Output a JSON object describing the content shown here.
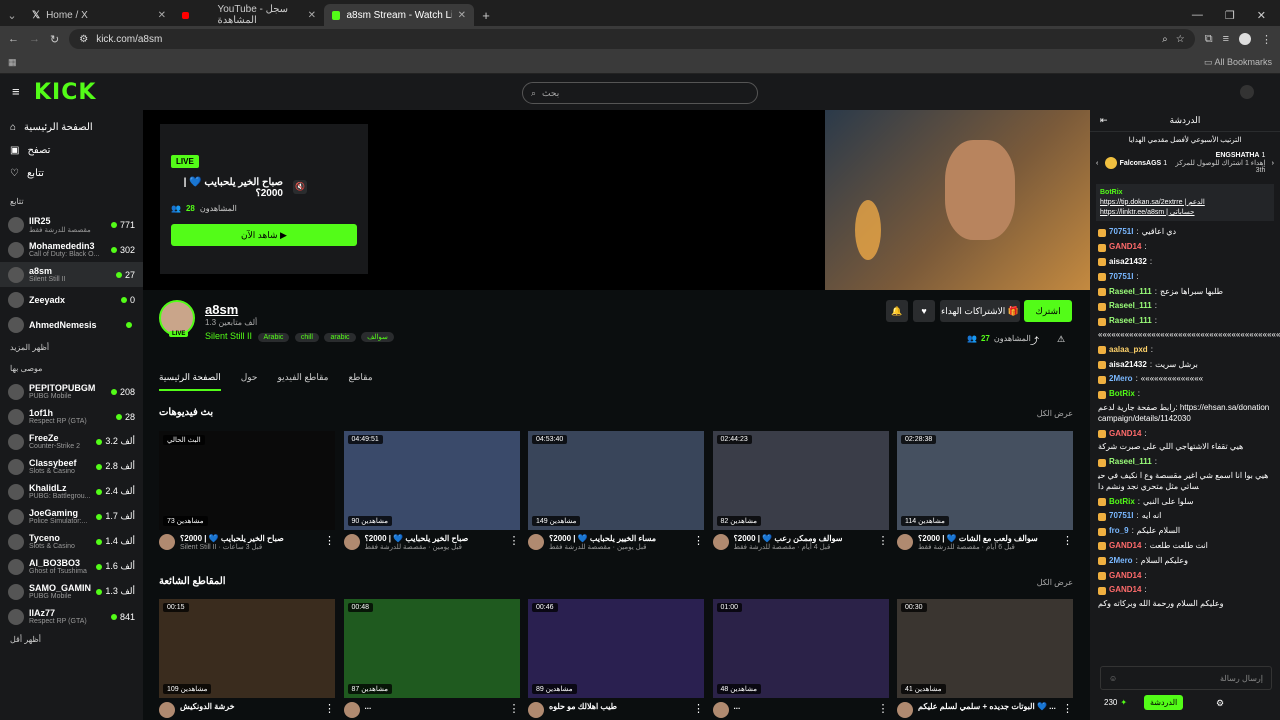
{
  "browser": {
    "tabs": [
      {
        "title": "Home / X"
      },
      {
        "title": "YouTube - سجل المشاهدة"
      },
      {
        "title": "a8sm Stream - Watch Live on Ki"
      }
    ],
    "url": "kick.com/a8sm",
    "bookmarks_label": "All Bookmarks"
  },
  "header": {
    "logo": "KICK",
    "search_placeholder": "بحث"
  },
  "sidebar": {
    "nav": [
      {
        "label": "الصفحة الرئيسية"
      },
      {
        "label": "تصفح"
      },
      {
        "label": "تتابع"
      }
    ],
    "following_title": "تتابع",
    "following": [
      {
        "name": "IIR25",
        "sub": "مقصصة للدرشة فقط",
        "viewers": "771"
      },
      {
        "name": "Mohamededin3",
        "sub": "Call of Duty: Black O...",
        "viewers": "302"
      },
      {
        "name": "a8sm",
        "sub": "Silent Still II",
        "viewers": "27"
      },
      {
        "name": "Zeeyadx",
        "sub": "",
        "viewers": "0"
      },
      {
        "name": "AhmedNemesis",
        "sub": "",
        "viewers": ""
      }
    ],
    "show_more": "أظهر المزيد",
    "recommended_title": "موصى بها",
    "recommended": [
      {
        "name": "PEPITOPUBGM",
        "sub": "PUBG Mobile",
        "viewers": "208"
      },
      {
        "name": "1of1h",
        "sub": "Respect RP (GTA)",
        "viewers": "28"
      },
      {
        "name": "FreeZe",
        "sub": "Counter-Strike 2",
        "viewers": "3.2 ألف"
      },
      {
        "name": "Classybeef",
        "sub": "Slots & Casino",
        "viewers": "2.8 ألف"
      },
      {
        "name": "KhalidLz",
        "sub": "PUBG: Battlegrou...",
        "viewers": "2.4 ألف"
      },
      {
        "name": "JoeGaming",
        "sub": "Police Simulator:...",
        "viewers": "1.7 ألف"
      },
      {
        "name": "Tyceno",
        "sub": "Slots & Casino",
        "viewers": "1.4 ألف"
      },
      {
        "name": "Al_BO3BO3",
        "sub": "Ghost of Tsushima",
        "viewers": "1.6 ألف"
      },
      {
        "name": "SAMO_GAMING",
        "sub": "PUBG Mobile",
        "viewers": "1.3 ألف"
      },
      {
        "name": "IIAz77",
        "sub": "Respect RP (GTA)",
        "viewers": "841"
      }
    ],
    "show_less": "أظهر أقل"
  },
  "stream": {
    "live_badge": "LIVE",
    "title": "صباح الخير يلحبايب 💙 | 2000؟",
    "viewers_label": "المشاهدون",
    "viewers": "28",
    "watch_now": "شاهد الآن ▶"
  },
  "channel": {
    "name": "a8sm",
    "followers": "1.3 ألف متابعين",
    "category": "Silent Still II",
    "tags": [
      "Arabic",
      "chill",
      "arabic",
      "سوالف"
    ],
    "subscribe": "اشترك",
    "gift_subs": "الاشتراكات الهداء",
    "viewers_label": "المشاهدون",
    "viewers": "27"
  },
  "channel_tabs": [
    {
      "label": "الصفحة الرئيسية"
    },
    {
      "label": "حول"
    },
    {
      "label": "مقاطع الفيديو"
    },
    {
      "label": "مقاطع"
    }
  ],
  "streams_section": {
    "title": "بث فيديوهات",
    "show_all": "عرض الكل",
    "items": [
      {
        "duration": "البث الحالي",
        "views": "73 مشاهدين",
        "title": "صباح الخير يلحبايب 💙 | 2000؟",
        "sub": "Silent Still II · قبل 3 ساعات"
      },
      {
        "duration": "04:49:51",
        "views": "90 مشاهدين",
        "title": "صباح الخير يلحبايب 💙 | 2000؟",
        "sub": "قبل يومين · مقصصة للدرشة فقط"
      },
      {
        "duration": "04:53:40",
        "views": "149 مشاهدين",
        "title": "مساء الخيير يلحبايب 💙 | 2000؟",
        "sub": "قبل يومين · مقصصة للدرشة فقط"
      },
      {
        "duration": "02:44:23",
        "views": "82 مشاهدين",
        "title": "سوالف وممكن رعب 💙 | 2000؟",
        "sub": "قبل 4 أيام · مقصصة للدرشة فقط"
      },
      {
        "duration": "02:28:38",
        "views": "114 مشاهدين",
        "title": "سوالف ولعب مع الشات 💙 | 2000؟",
        "sub": "قبل 6 أيام · مقصصة للدرشة فقط"
      }
    ]
  },
  "clips_section": {
    "title": "المقاطع الشائعة",
    "show_all": "عرض الكل",
    "items": [
      {
        "duration": "00:15",
        "views": "109 مشاهدين",
        "title": "خرشة الدونكيش"
      },
      {
        "duration": "00:48",
        "views": "87 مشاهدين",
        "title": "..."
      },
      {
        "duration": "00:46",
        "views": "89 مشاهدين",
        "title": "طيب اهلالك مو حلوه"
      },
      {
        "duration": "01:00",
        "views": "48 مشاهدين",
        "title": "..."
      },
      {
        "duration": "00:30",
        "views": "41 مشاهدين",
        "title": "البوتات جديده + سلمي لسلم عليكم 💙 ..."
      }
    ]
  },
  "chat": {
    "title": "الدردشة",
    "leaderboard_title": "الترتيب الأسبوعي لأفضل مقدمي الهدايا",
    "leader1": "FalconsAGS",
    "leader1_count": "1",
    "leader2": "ENGSHATHA",
    "leader2_count": "1",
    "leader2_sub": "إهداء 1 اشتراك للوصول للمركز 3th",
    "pinned_user": "BotRix",
    "pinned_text": "https://tip.dokan.sa/2extrre | الدعم",
    "pinned_text2": "https://linktr.ee/a8sm | حساباتي",
    "messages": [
      {
        "user": "70751I",
        "text": "دي اعاقيي",
        "color": "#7ab8ff"
      },
      {
        "user": "GAND14",
        "text": "",
        "color": "#ff6b6b"
      },
      {
        "user": "aisa21432",
        "text": "",
        "color": "#ffffff"
      },
      {
        "user": "70751I",
        "text": "",
        "color": "#7ab8ff"
      },
      {
        "user": "Raseel_111",
        "text": "طلبها سبراها مزعج",
        "color": "#9bff7a"
      },
      {
        "user": "Raseel_111",
        "text": "",
        "color": "#9bff7a"
      },
      {
        "user": "Raseel_111",
        "text": "««««««««««««««««««««««««««««««««««««««««««",
        "color": "#9bff7a"
      },
      {
        "user": "aalaa_pxd",
        "text": "",
        "color": "#ffd36b"
      },
      {
        "user": "aisa21432",
        "text": "برشل سريت",
        "color": "#ffffff"
      },
      {
        "user": "2Mero",
        "text": "««««««««««««««",
        "color": "#7ab8ff"
      },
      {
        "user": "BotRix",
        "text": "رابط صفحة جارية لدعم: https://ehsan.sa/donationcampaign/details/1142030",
        "color": "#53fc18"
      },
      {
        "user": "GAND14",
        "text": "هيي تقفاء الاشتهاجي اللي على صبرت شركة",
        "color": "#ff6b6b"
      },
      {
        "user": "Raseel_111",
        "text": "هيي بوا انا اسمع شي اغير مقسصة وع ا نكيف في حيساتي مثل متحري نجد ونشم دا",
        "color": "#9bff7a"
      },
      {
        "user": "BotRix",
        "text": "سلوا على النبي",
        "color": "#53fc18"
      },
      {
        "user": "70751I",
        "text": "انه ايه",
        "color": "#7ab8ff"
      },
      {
        "user": "fro_9",
        "text": "السلام عليكم",
        "color": "#7ab8ff"
      },
      {
        "user": "GAND14",
        "text": "انت طلعت طلعت",
        "color": "#ff6b6b"
      },
      {
        "user": "2Mero",
        "text": "وعليكم السلام",
        "color": "#7ab8ff"
      },
      {
        "user": "GAND14",
        "text": "",
        "color": "#ff6b6b"
      },
      {
        "user": "GAND14",
        "text": "وعليكم السلام ورحمة الله وبركاته وكم",
        "color": "#ff6b6b"
      }
    ],
    "input_placeholder": "إرسال رسالة",
    "points": "230",
    "send_label": "الدردشة"
  }
}
